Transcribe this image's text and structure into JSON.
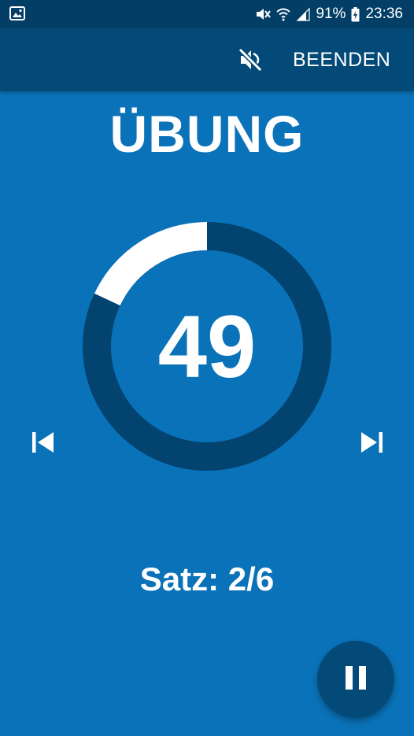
{
  "status_bar": {
    "left_icon": "image-notification-icon",
    "icons": [
      "mute-icon",
      "wifi-icon",
      "signal-icon"
    ],
    "battery_percent": "91%",
    "time": "23:36"
  },
  "toolbar": {
    "mute_icon": "volume-off-icon",
    "end_label": "BEENDEN"
  },
  "exercise": {
    "title": "ÜBUNG",
    "countdown": "49",
    "progress_fraction": 0.18,
    "set_label": "Satz: 2/6"
  },
  "controls": {
    "prev_icon": "skip-previous-icon",
    "next_icon": "skip-next-icon",
    "pause_icon": "pause-icon"
  },
  "colors": {
    "background": "#0a72b8",
    "toolbar": "#044a78",
    "status_bar": "#033e66",
    "ring_track": "#03436f",
    "ring_progress": "#ffffff"
  }
}
